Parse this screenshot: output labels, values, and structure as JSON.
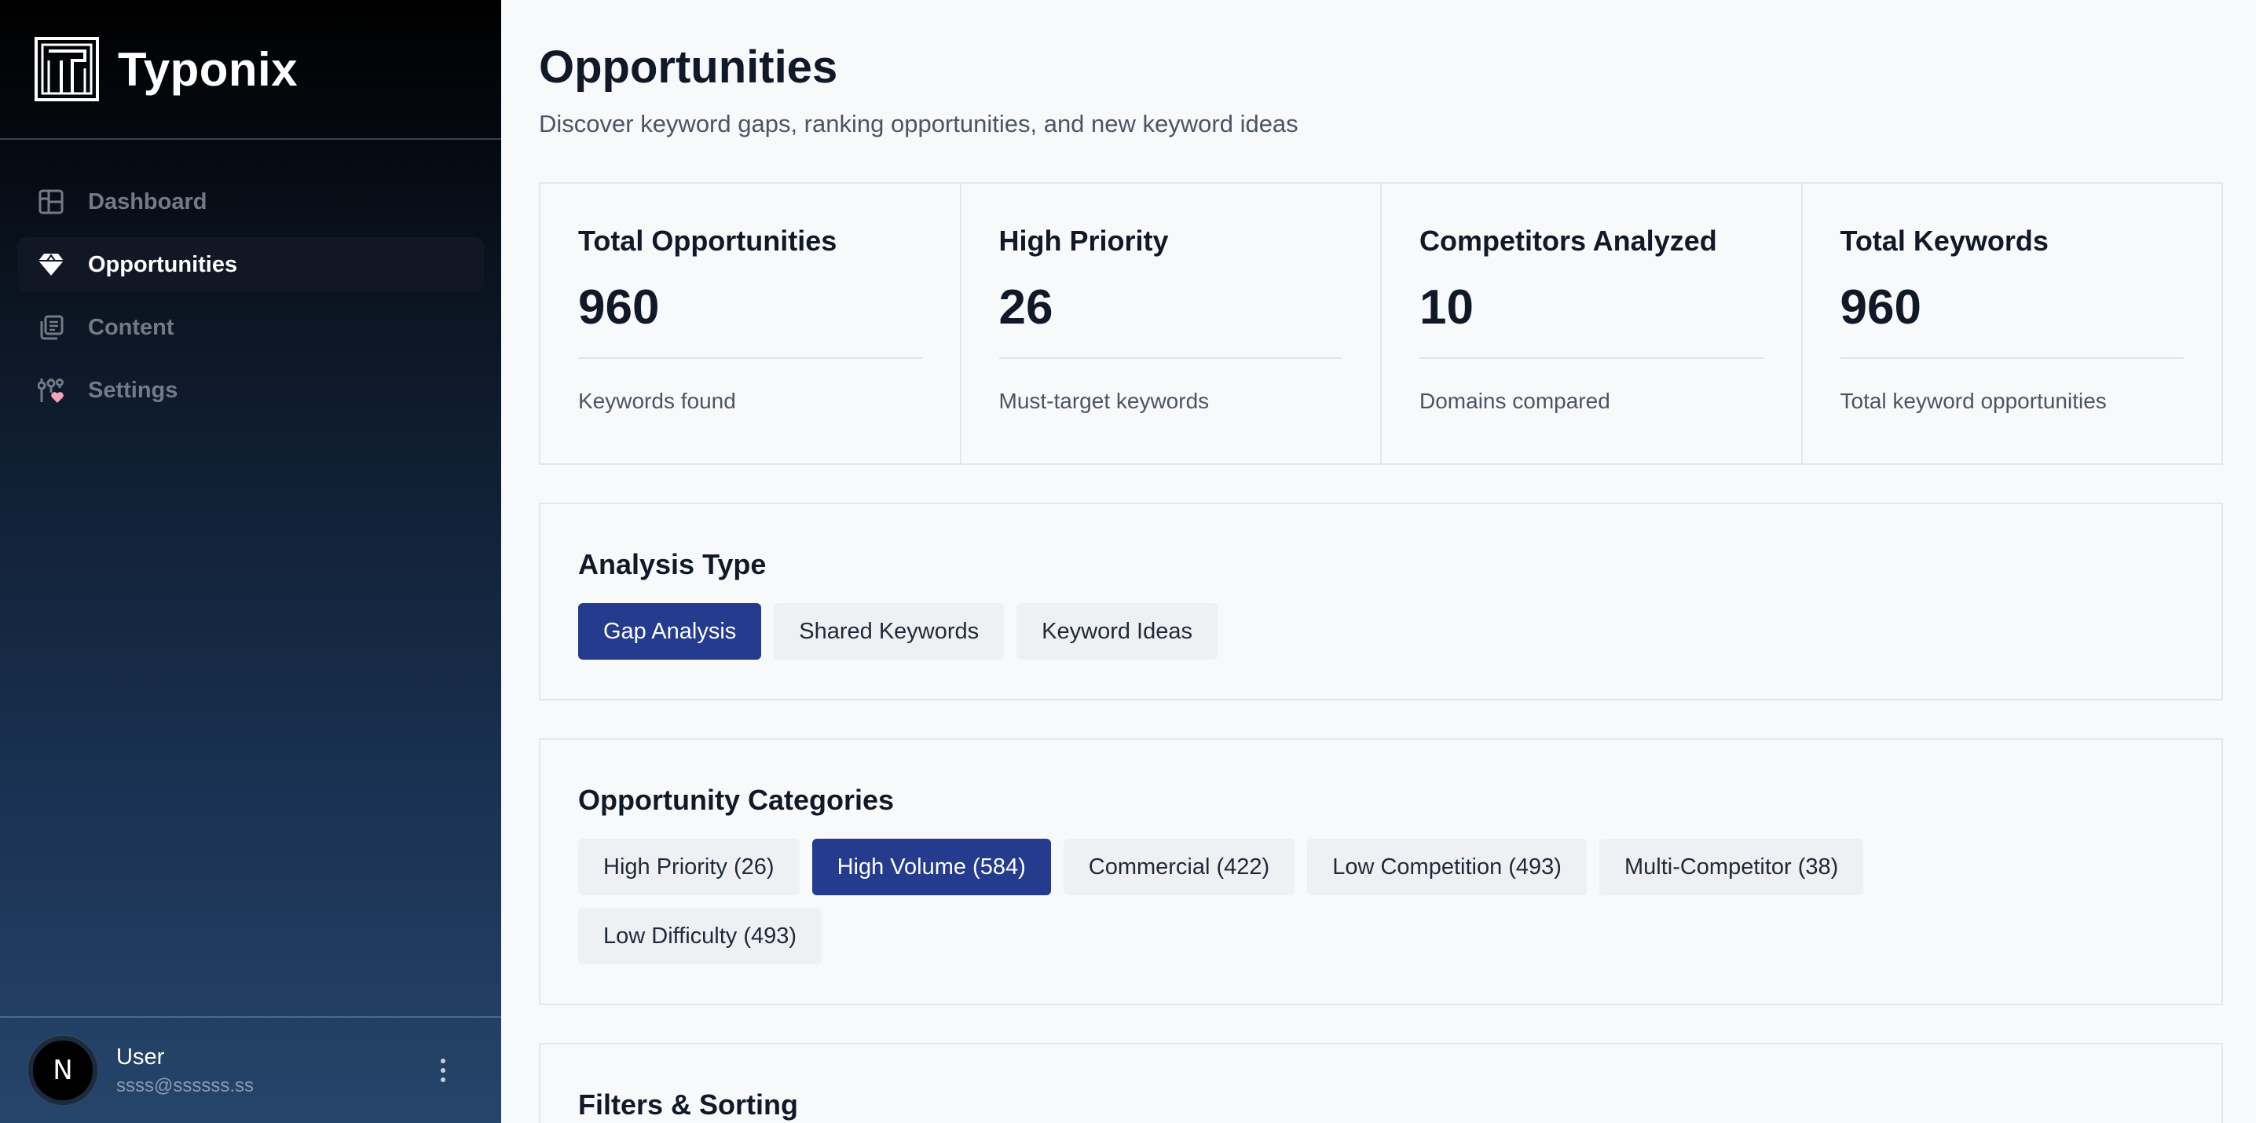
{
  "brand": {
    "name": "Typonix"
  },
  "nav": {
    "items": [
      {
        "label": "Dashboard",
        "icon": "layout-icon",
        "active": false
      },
      {
        "label": "Opportunities",
        "icon": "gem-icon",
        "active": true
      },
      {
        "label": "Content",
        "icon": "documents-icon",
        "active": false
      },
      {
        "label": "Settings",
        "icon": "sliders-heart-icon",
        "active": false
      }
    ]
  },
  "user": {
    "avatar_letter": "N",
    "name": "User",
    "email": "ssss@ssssss.ss"
  },
  "page": {
    "title": "Opportunities",
    "subtitle": "Discover keyword gaps, ranking opportunities, and new keyword ideas"
  },
  "stats": [
    {
      "label": "Total Opportunities",
      "value": "960",
      "desc": "Keywords found"
    },
    {
      "label": "High Priority",
      "value": "26",
      "desc": "Must-target keywords"
    },
    {
      "label": "Competitors Analyzed",
      "value": "10",
      "desc": "Domains compared"
    },
    {
      "label": "Total Keywords",
      "value": "960",
      "desc": "Total keyword opportunities"
    }
  ],
  "analysis": {
    "title": "Analysis Type",
    "options": [
      "Gap Analysis",
      "Shared Keywords",
      "Keyword Ideas"
    ],
    "selected": "Gap Analysis"
  },
  "categories": {
    "title": "Opportunity Categories",
    "options": [
      "High Priority (26)",
      "High Volume (584)",
      "Commercial (422)",
      "Low Competition (493)",
      "Multi-Competitor (38)",
      "Low Difficulty (493)"
    ],
    "selected": "High Volume (584)"
  },
  "filters": {
    "title": "Filters & Sorting"
  },
  "colors": {
    "accent": "#243b8e",
    "sidebar_top": "#000000",
    "sidebar_bottom": "#26456b"
  }
}
